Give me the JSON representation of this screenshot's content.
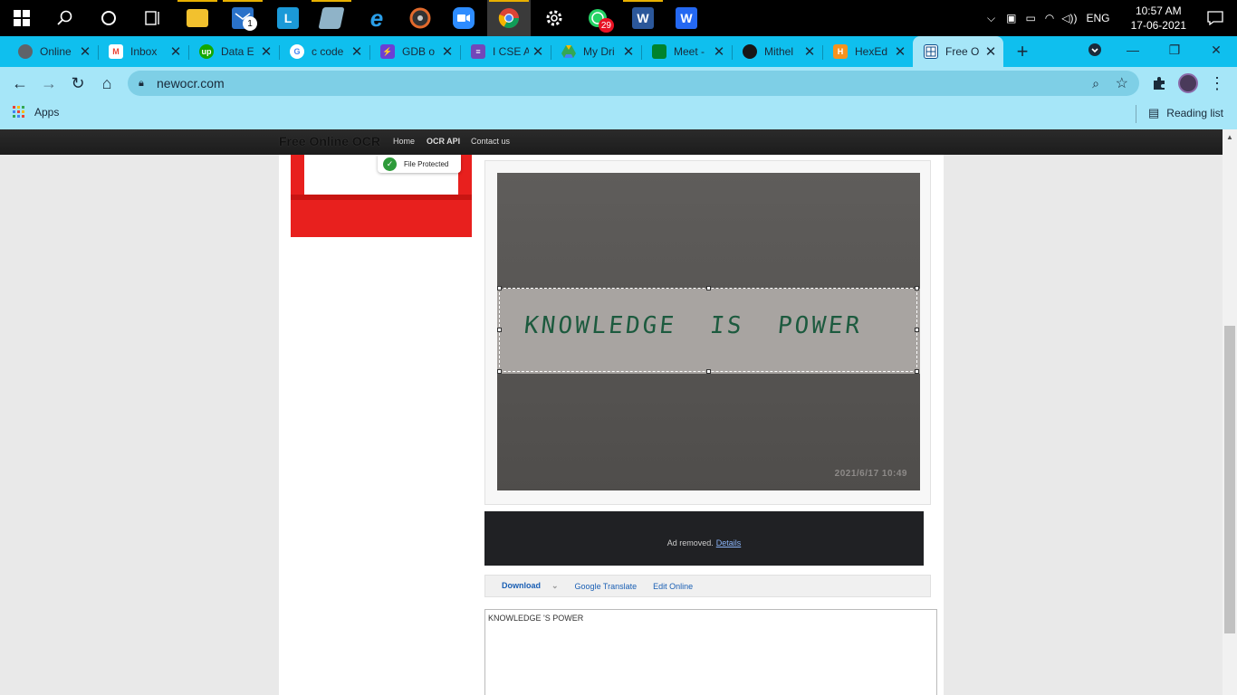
{
  "taskbar": {
    "apps": [
      {
        "name": "start",
        "label": ""
      },
      {
        "name": "search",
        "label": ""
      },
      {
        "name": "cortana",
        "label": ""
      },
      {
        "name": "task-view",
        "label": ""
      },
      {
        "name": "file-explorer",
        "label": ""
      },
      {
        "name": "mail",
        "label": "",
        "badge": "1"
      },
      {
        "name": "lenovo",
        "label": "L"
      },
      {
        "name": "notes",
        "label": ""
      },
      {
        "name": "internet-explorer",
        "label": "e"
      },
      {
        "name": "music",
        "label": ""
      },
      {
        "name": "zoom",
        "label": ""
      },
      {
        "name": "chrome",
        "label": ""
      },
      {
        "name": "settings",
        "label": ""
      },
      {
        "name": "whatsapp",
        "label": "",
        "badge": "29"
      },
      {
        "name": "word",
        "label": "W"
      },
      {
        "name": "wps",
        "label": "W"
      }
    ],
    "lang": "ENG",
    "time": "10:57 AM",
    "date": "17-06-2021"
  },
  "tabs": [
    {
      "title": "Online",
      "favicon_color": "#5f6368"
    },
    {
      "title": "Inbox",
      "favicon_color": "#ea4335"
    },
    {
      "title": "Data E",
      "favicon_color": "#14a800",
      "fav_text": "up"
    },
    {
      "title": "c code",
      "favicon_color": "#4285f4",
      "fav_text": "G"
    },
    {
      "title": "GDB o",
      "favicon_color": "#6b3fd4"
    },
    {
      "title": "I CSE A",
      "favicon_color": "#7248b9"
    },
    {
      "title": "My Dri",
      "favicon_color": "#34a853"
    },
    {
      "title": "Meet -",
      "favicon_color": "#00832d"
    },
    {
      "title": "Mithel",
      "favicon_color": "#181717"
    },
    {
      "title": "HexEd",
      "favicon_color": "#f7931e"
    },
    {
      "title": "Free O",
      "favicon_color": "#0d4d8a",
      "active": true
    }
  ],
  "address": {
    "url": "newocr.com"
  },
  "bookmarks": {
    "apps_label": "Apps",
    "reading_list": "Reading list"
  },
  "site": {
    "title": "Free Online OCR",
    "nav": [
      "Home",
      "OCR API",
      "Contact us"
    ],
    "ad_badge": "File Protected",
    "image_text": "KNOWLEDGE  IS  POWER",
    "image_timestamp": "2021/6/17 10:49",
    "ad_removed": "Ad removed.",
    "ad_details": "Details",
    "actions": {
      "download": "Download",
      "translate": "Google Translate",
      "edit": "Edit Online"
    },
    "result_text": "KNOWLEDGE 'S POWER"
  }
}
